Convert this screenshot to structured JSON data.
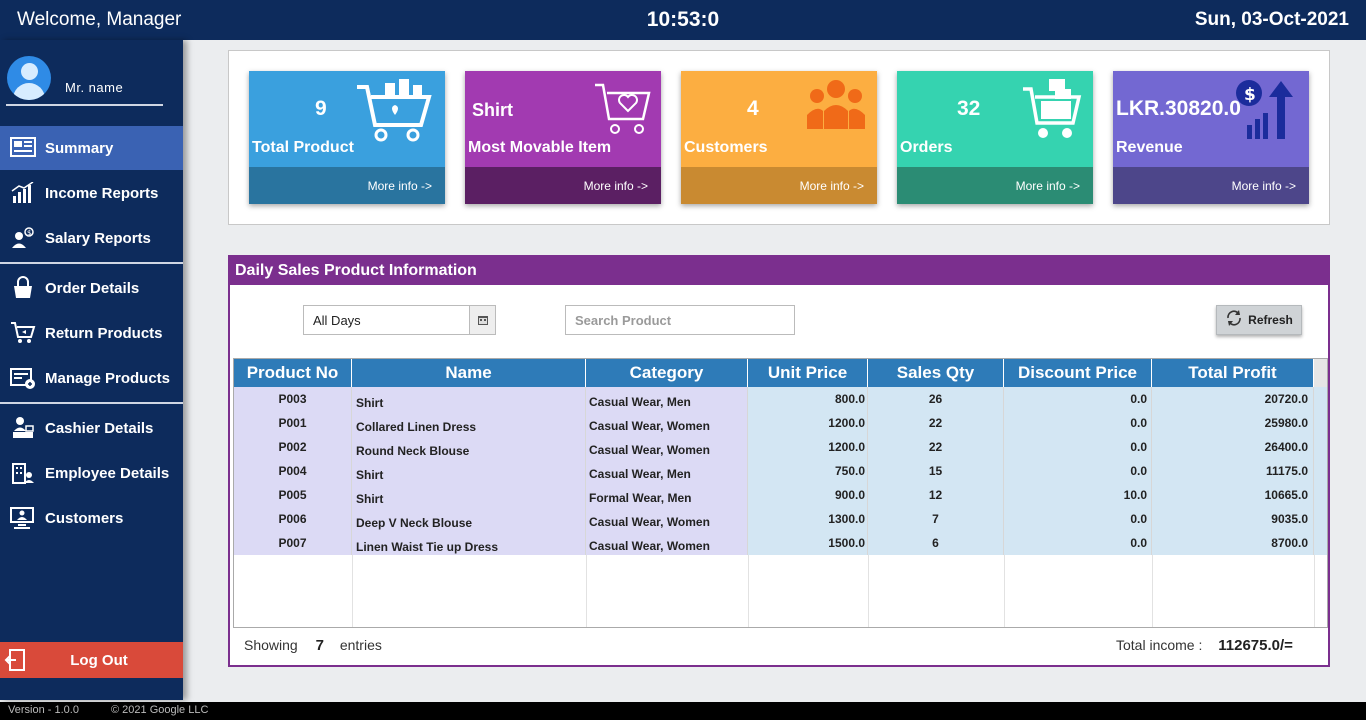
{
  "topbar": {
    "welcome": "Welcome, Manager",
    "time": "10:53:0",
    "date": "Sun, 03-Oct-2021"
  },
  "user": {
    "name": "Mr. name"
  },
  "nav": [
    {
      "label": "Summary",
      "icon": "summary-dashboard-icon"
    },
    {
      "label": "Income Reports",
      "icon": "income-chart-icon"
    },
    {
      "label": "Salary Reports",
      "icon": "salary-person-icon"
    },
    {
      "label": "Order Details",
      "icon": "shopping-bag-icon"
    },
    {
      "label": "Return Products",
      "icon": "return-cart-icon"
    },
    {
      "label": "Manage Products",
      "icon": "manage-products-icon"
    },
    {
      "label": "Cashier Details",
      "icon": "cashier-icon"
    },
    {
      "label": "Employee Details",
      "icon": "employee-building-icon"
    },
    {
      "label": "Customers",
      "icon": "customers-monitor-icon"
    }
  ],
  "logout": {
    "label": "Log Out",
    "icon": "logout-door-icon"
  },
  "cards": [
    {
      "value": "9",
      "label": "Total Product",
      "more": "More info ->",
      "icon": "product-cart-icon",
      "color": "#3aa0de",
      "footer": "#29749f"
    },
    {
      "value": "Shirt",
      "label": "Most Movable Item",
      "more": "More info ->",
      "icon": "cart-heart-icon",
      "color": "#a23ab1",
      "footer": "#5b1f63"
    },
    {
      "value": "4",
      "label": "Customers",
      "more": "More info ->",
      "icon": "customers-group-icon",
      "color": "#fcae41",
      "footer": "#c98a31"
    },
    {
      "value": "32",
      "label": "Orders",
      "more": "More info ->",
      "icon": "orders-cart-icon",
      "color": "#35d3b0",
      "footer": "#2b8c74"
    },
    {
      "value": "LKR.30820.0",
      "label": "Revenue",
      "more": "More info ->",
      "icon": "revenue-growth-icon",
      "color": "#7368d2",
      "footer": "#4d468a"
    }
  ],
  "panel": {
    "title": "Daily Sales Product Information",
    "filter": "All Days",
    "search_placeholder": "Search Product",
    "refresh": "Refresh"
  },
  "table": {
    "columns": [
      "Product No",
      "Name",
      "Category",
      "Unit Price",
      "Sales Qty",
      "Discount Price",
      "Total Profit"
    ],
    "rows": [
      [
        "P003",
        "Shirt",
        "Casual Wear, Men",
        "800.0",
        "26",
        "0.0",
        "20720.0"
      ],
      [
        "P001",
        "Collared Linen Dress",
        "Casual Wear, Women",
        "1200.0",
        "22",
        "0.0",
        "25980.0"
      ],
      [
        "P002",
        "Round Neck Blouse",
        "Casual Wear, Women",
        "1200.0",
        "22",
        "0.0",
        "26400.0"
      ],
      [
        "P004",
        "Shirt",
        "Casual Wear, Men",
        "750.0",
        "15",
        "0.0",
        "11175.0"
      ],
      [
        "P005",
        "Shirt",
        "Formal Wear, Men",
        "900.0",
        "12",
        "10.0",
        "10665.0"
      ],
      [
        "P006",
        "Deep V Neck Blouse",
        "Casual Wear, Women",
        "1300.0",
        "7",
        "0.0",
        "9035.0"
      ],
      [
        "P007",
        "Linen Waist Tie up Dress",
        "Casual Wear, Women",
        "1500.0",
        "6",
        "0.0",
        "8700.0"
      ]
    ]
  },
  "summary": {
    "showing": "Showing",
    "count": "7",
    "entries": "entries",
    "income_label": "Total income :",
    "income_value": "112675.0/="
  },
  "footer": {
    "version": "Version - 1.0.0",
    "copyright": "© 2021 Google LLC"
  }
}
